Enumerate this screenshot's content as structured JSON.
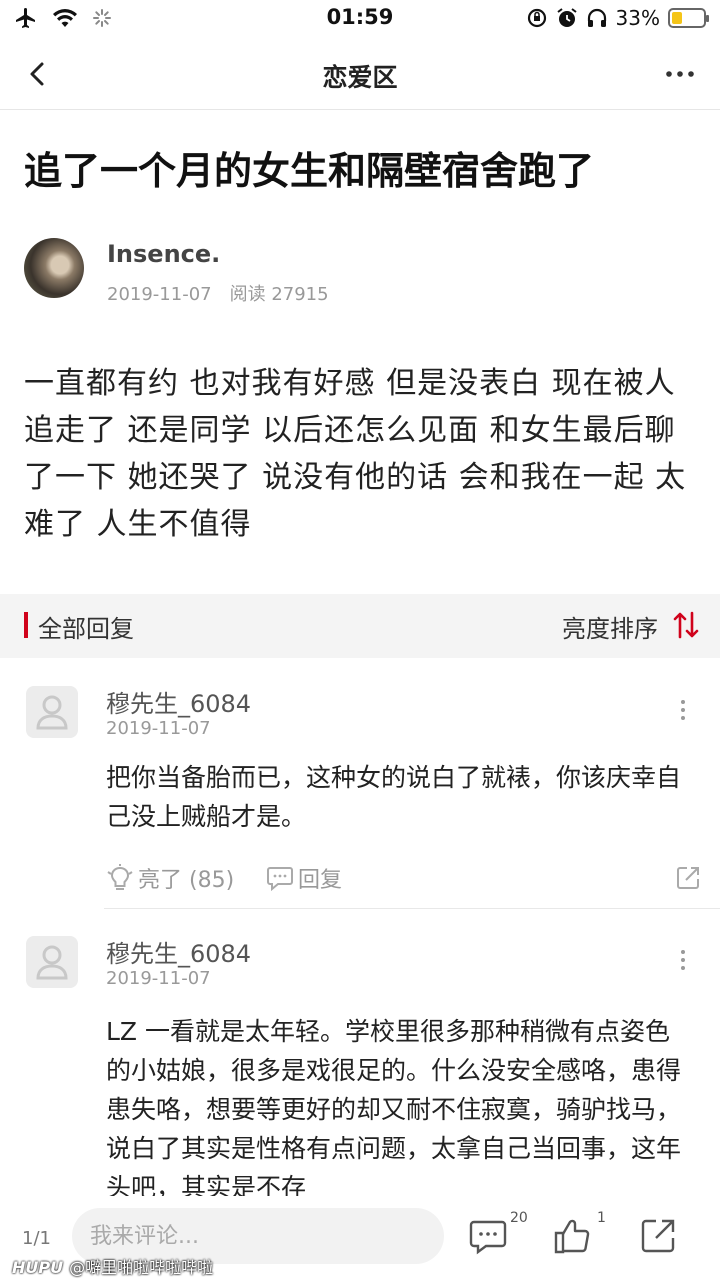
{
  "status_bar": {
    "time": "01:59",
    "battery_text": "33%",
    "battery_level": 0.33,
    "icons": [
      "airplane-icon",
      "wifi-icon",
      "loading-icon",
      "rotation-lock-icon",
      "alarm-icon",
      "headphones-icon",
      "battery-icon"
    ]
  },
  "nav": {
    "title": "恋爱区",
    "back_icon": "chevron-left-icon",
    "more_icon": "more-horizontal-icon"
  },
  "post": {
    "title": "追了一个月的女生和隔壁宿舍跑了",
    "author": "Insence.",
    "date": "2019-11-07",
    "reads": "阅读 27915",
    "body": "一直都有约 也对我有好感 但是没表白 现在被人追走了 还是同学 以后还怎么见面 和女生最后聊了一下 她还哭了 说没有他的话 会和我在一起 太难了 人生不值得"
  },
  "replies": {
    "header": "全部回复",
    "sort_label": "亮度排序",
    "accent_color": "#d0021b"
  },
  "comments": [
    {
      "name": "穆先生_6084",
      "date": "2019-11-07",
      "text": "把你当备胎而已，这种女的说白了就裱，你该庆幸自己没上贼船才是。",
      "like_label": "亮了 (85)",
      "reply_label": "回复"
    },
    {
      "name": "穆先生_6084",
      "date": "2019-11-07",
      "text": "LZ 一看就是太年轻。学校里很多那种稍微有点姿色的小姑娘，很多是戏很足的。什么没安全感咯，患得患失咯，想要等更好的却又耐不住寂寞，骑驴找马，说白了其实是性格有点问题，太拿自己当回事，这年头吧，其实是不存"
    }
  ],
  "bottom_bar": {
    "page": "1/1",
    "input_placeholder": "我来评论...",
    "comment_count": "20",
    "like_count": "1"
  },
  "watermark": {
    "brand": "HUPU",
    "handle": "@噼里啪啦哔啦哔啦"
  }
}
